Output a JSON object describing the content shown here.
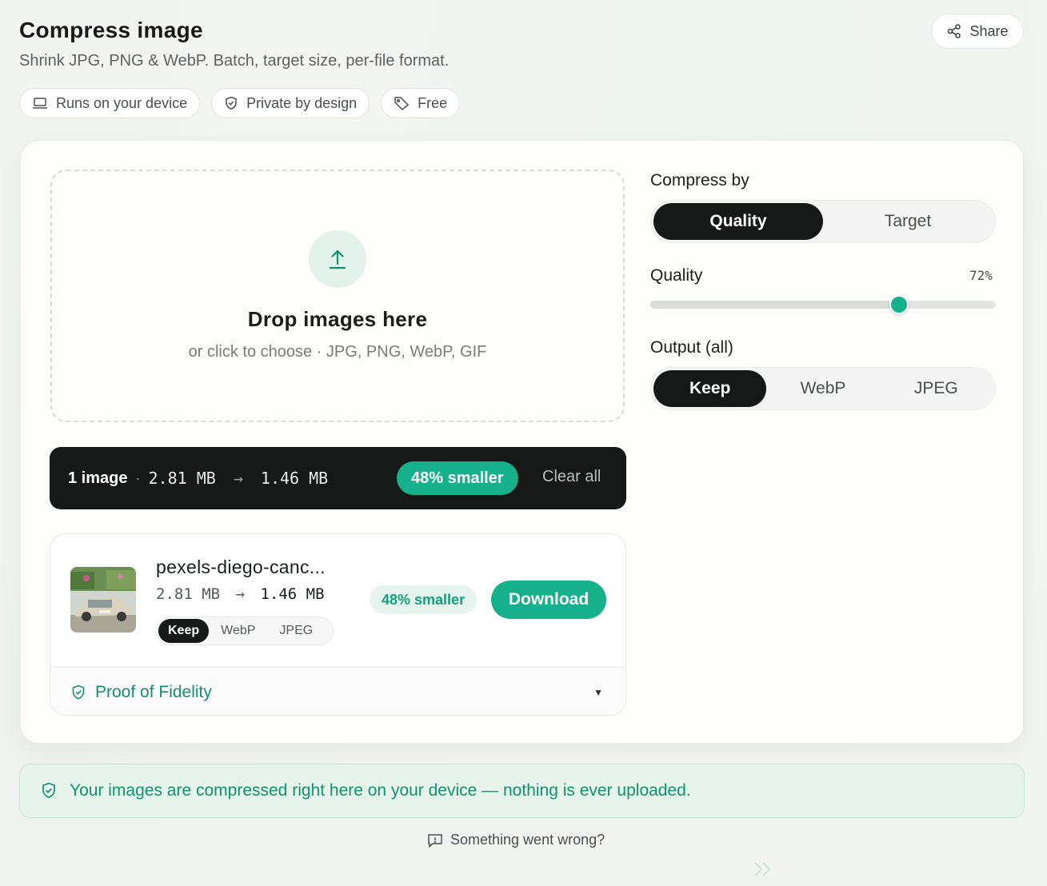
{
  "header": {
    "title": "Compress image",
    "subtitle": "Shrink JPG, PNG & WebP. Batch, target size, per-file format.",
    "share_label": "Share"
  },
  "pills": [
    {
      "label": "Runs on your device",
      "icon": "laptop-icon"
    },
    {
      "label": "Private by design",
      "icon": "shield-check-icon"
    },
    {
      "label": "Free",
      "icon": "tag-icon"
    }
  ],
  "dropzone": {
    "title": "Drop images here",
    "subtitle": "or click to choose · JPG, PNG, WebP, GIF",
    "icon": "upload-icon"
  },
  "summary": {
    "count": "1 image",
    "separator": "·",
    "original": "2.81 MB",
    "arrow": "→",
    "compressed": "1.46 MB",
    "badge": "48% smaller",
    "clear_label": "Clear all"
  },
  "file": {
    "name": "pexels-diego-canc...",
    "original": "2.81 MB",
    "arrow": "→",
    "compressed": "1.46 MB",
    "formats": [
      "Keep",
      "WebP",
      "JPEG"
    ],
    "selected_format": "Keep",
    "badge": "48% smaller",
    "download_label": "Download",
    "proof_label": "Proof of Fidelity",
    "proof_caret": "▼"
  },
  "settings": {
    "compress_by_label": "Compress by",
    "compress_by_options": [
      "Quality",
      "Target"
    ],
    "compress_by_selected": "Quality",
    "quality_label": "Quality",
    "quality_value": "72%",
    "quality_fraction": 0.72,
    "output_label": "Output (all)",
    "output_options": [
      "Keep",
      "WebP",
      "JPEG"
    ],
    "output_selected": "Keep"
  },
  "privacy_banner": "Your images are compressed right here on your device — nothing is ever uploaded.",
  "report_label": "Something went wrong?",
  "colors": {
    "accent": "#16b08a",
    "accent_text": "#13906f",
    "dark": "#171918",
    "badge_bg": "#e5f4ec"
  }
}
